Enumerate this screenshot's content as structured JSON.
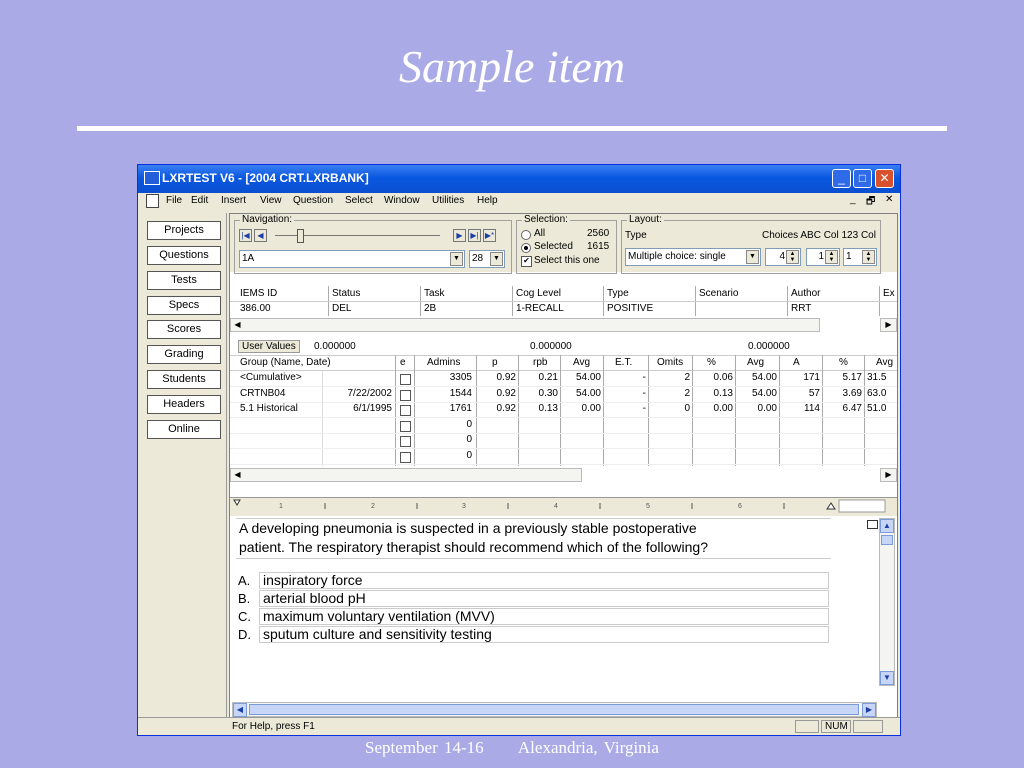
{
  "slide": {
    "title": "Sample item",
    "footer_date": "September 14-16",
    "footer_place": "Alexandria, Virginia"
  },
  "window": {
    "title": "LXRTEST V6 - [2004 CRT.LXRBANK]",
    "controls": {
      "minimize": "_",
      "maximize": "□",
      "close": "✕"
    }
  },
  "menu": [
    "File",
    "Edit",
    "Insert",
    "View",
    "Question",
    "Select",
    "Window",
    "Utilities",
    "Help"
  ],
  "mdi_controls": [
    "_",
    "🗗",
    "✕"
  ],
  "sidebar": [
    "Projects",
    "Questions",
    "Tests",
    "Specs",
    "Scores",
    "Grading",
    "Students",
    "Headers",
    "Online"
  ],
  "navigation": {
    "label": "Navigation:",
    "item_value": "1A",
    "count_value": "28"
  },
  "selection": {
    "label": "Selection:",
    "all_label": "All",
    "all_count": "2560",
    "selected_label": "Selected",
    "selected_count": "1615",
    "select_this_label": "Select this one",
    "mode": "Selected",
    "select_this_checked": true
  },
  "layout": {
    "label": "Layout:",
    "type_label": "Type",
    "choices_label": "Choices ABC Col 123 Col",
    "type_value": "Multiple choice: single",
    "choices_value": "4",
    "col1_value": "1",
    "col2_value": "1"
  },
  "item_info": {
    "headers": [
      "IEMS ID",
      "Status",
      "Task",
      "Cog Level",
      "Type",
      "Scenario",
      "Author",
      "Ex"
    ],
    "values": [
      "386.00",
      "DEL",
      "2B",
      "1-RECALL",
      "POSITIVE",
      "",
      "RRT",
      ""
    ]
  },
  "user_values": {
    "label": "User Values",
    "values": [
      "0.000000",
      "0.000000",
      "0.000000"
    ]
  },
  "stats": {
    "headers": [
      "Group (Name, Date)",
      "e",
      "Admins",
      "p",
      "rpb",
      "Avg",
      "E.T.",
      "Omits",
      "%",
      "Avg",
      "A",
      "%",
      "Avg"
    ],
    "rows": [
      {
        "name": "<Cumulative>",
        "date": "",
        "admins": "3305",
        "p": "0.92",
        "rpb": "0.21",
        "avg": "54.00",
        "et": "-",
        "omits": "2",
        "pct": "0.06",
        "avg2": "54.00",
        "a": "171",
        "pct2": "5.17",
        "avg3": "31.5"
      },
      {
        "name": "CRTNB04",
        "date": "7/22/2002",
        "admins": "1544",
        "p": "0.92",
        "rpb": "0.30",
        "avg": "54.00",
        "et": "-",
        "omits": "2",
        "pct": "0.13",
        "avg2": "54.00",
        "a": "57",
        "pct2": "3.69",
        "avg3": "63.0"
      },
      {
        "name": "5.1 Historical",
        "date": "6/1/1995",
        "admins": "1761",
        "p": "0.92",
        "rpb": "0.13",
        "avg": "0.00",
        "et": "-",
        "omits": "0",
        "pct": "0.00",
        "avg2": "0.00",
        "a": "114",
        "pct2": "6.47",
        "avg3": "51.0"
      },
      {
        "name": "",
        "date": "",
        "admins": "0"
      },
      {
        "name": "",
        "date": "",
        "admins": "0"
      },
      {
        "name": "",
        "date": "",
        "admins": "0"
      }
    ]
  },
  "question": {
    "stem_line1": "A developing pneumonia is suspected in a previously stable postoperative",
    "stem_line2": "patient.  The respiratory therapist should recommend which of the following?",
    "options": [
      {
        "letter": "A.",
        "text": "inspiratory force"
      },
      {
        "letter": "B.",
        "text": "arterial blood pH"
      },
      {
        "letter": "C.",
        "text": "maximum voluntary ventilation (MVV)"
      },
      {
        "letter": "D.",
        "text": "sputum culture and sensitivity testing"
      }
    ]
  },
  "statusbar": {
    "help": "For Help, press F1",
    "num": "NUM"
  }
}
